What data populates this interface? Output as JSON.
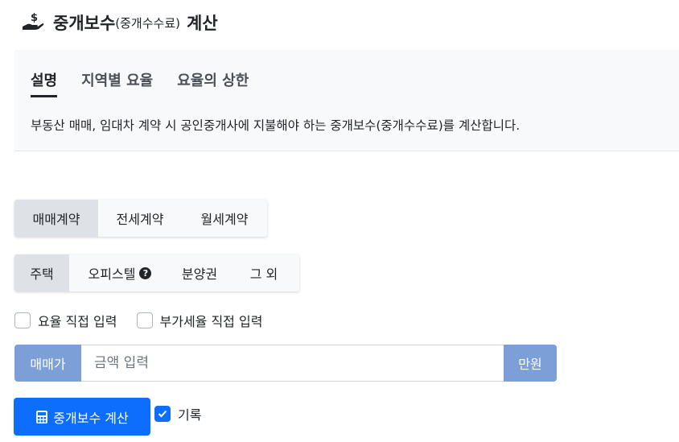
{
  "header": {
    "icon": "hand-coin-icon",
    "title_main": "중개보수",
    "title_paren": "(중개수수료)",
    "title_suffix": "계산"
  },
  "info": {
    "tabs": [
      {
        "label": "설명",
        "active": true
      },
      {
        "label": "지역별 요율",
        "active": false
      },
      {
        "label": "요율의 상한",
        "active": false
      }
    ],
    "description": "부동산 매매, 임대차 계약 시 공인중개사에 지불해야 하는 중개보수(중개수수료)를 계산합니다."
  },
  "contract_types": [
    {
      "label": "매매계약",
      "active": true
    },
    {
      "label": "전세계약",
      "active": false
    },
    {
      "label": "월세계약",
      "active": false
    }
  ],
  "property_types": [
    {
      "label": "주택",
      "active": true
    },
    {
      "label": "오피스텔",
      "active": false,
      "help_icon": "question-circle-icon"
    },
    {
      "label": "분양권",
      "active": false
    },
    {
      "label": "그 외",
      "active": false
    }
  ],
  "options": {
    "rate_manual": {
      "label": "요율 직접 입력",
      "checked": false
    },
    "vat_manual": {
      "label": "부가세율 직접 입력",
      "checked": false
    }
  },
  "price_input": {
    "prefix": "매매가",
    "placeholder": "금액 입력",
    "value": "",
    "suffix": "만원"
  },
  "calculate_button": {
    "label": "중개보수 계산",
    "icon": "calculator-icon"
  },
  "record": {
    "label": "기록",
    "checked": true
  },
  "colors": {
    "primary": "#0d6efd",
    "input_addon": "#7c9fd8",
    "card_bg": "#f8f9fa",
    "active_segment": "#dee2e6"
  }
}
